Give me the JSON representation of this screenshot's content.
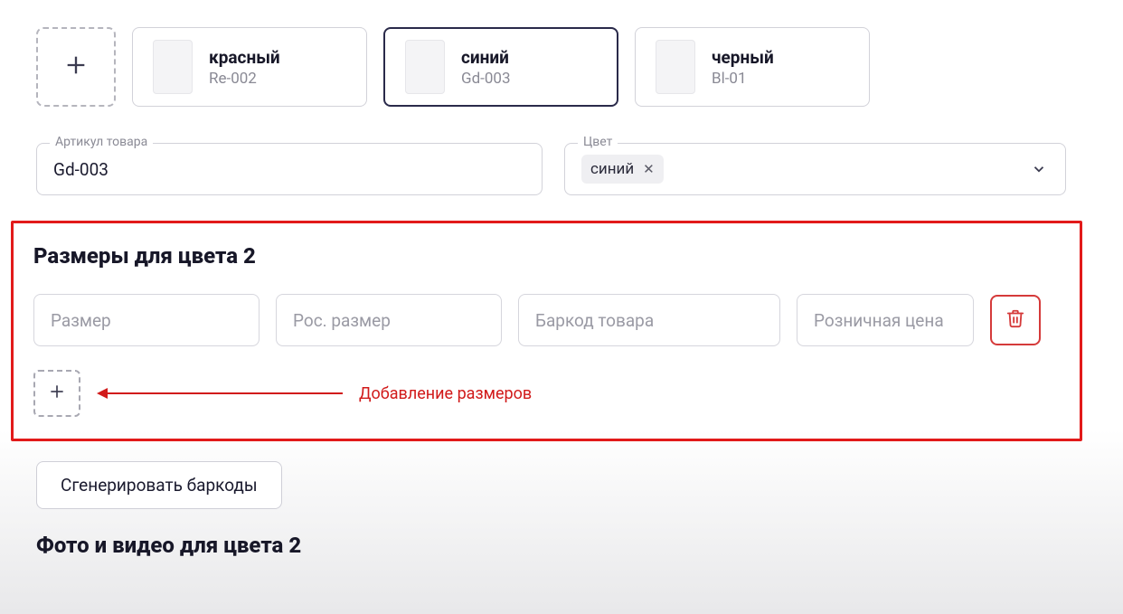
{
  "color_cards": [
    {
      "name": "красный",
      "sku": "Re-002",
      "selected": false
    },
    {
      "name": "синий",
      "sku": "Gd-003",
      "selected": true
    },
    {
      "name": "черный",
      "sku": "Bl-01",
      "selected": false
    }
  ],
  "article": {
    "label": "Артикул товара",
    "value": "Gd-003"
  },
  "color_field": {
    "label": "Цвет",
    "chip": "синий"
  },
  "sizes_section": {
    "title": "Размеры для цвета 2",
    "placeholders": {
      "size": "Размер",
      "ru_size": "Рос. размер",
      "barcode": "Баркод товара",
      "price": "Розничная цена"
    },
    "annotation": "Добавление размеров"
  },
  "generate_button": "Сгенерировать баркоды",
  "media_title": "Фото и видео для цвета 2"
}
